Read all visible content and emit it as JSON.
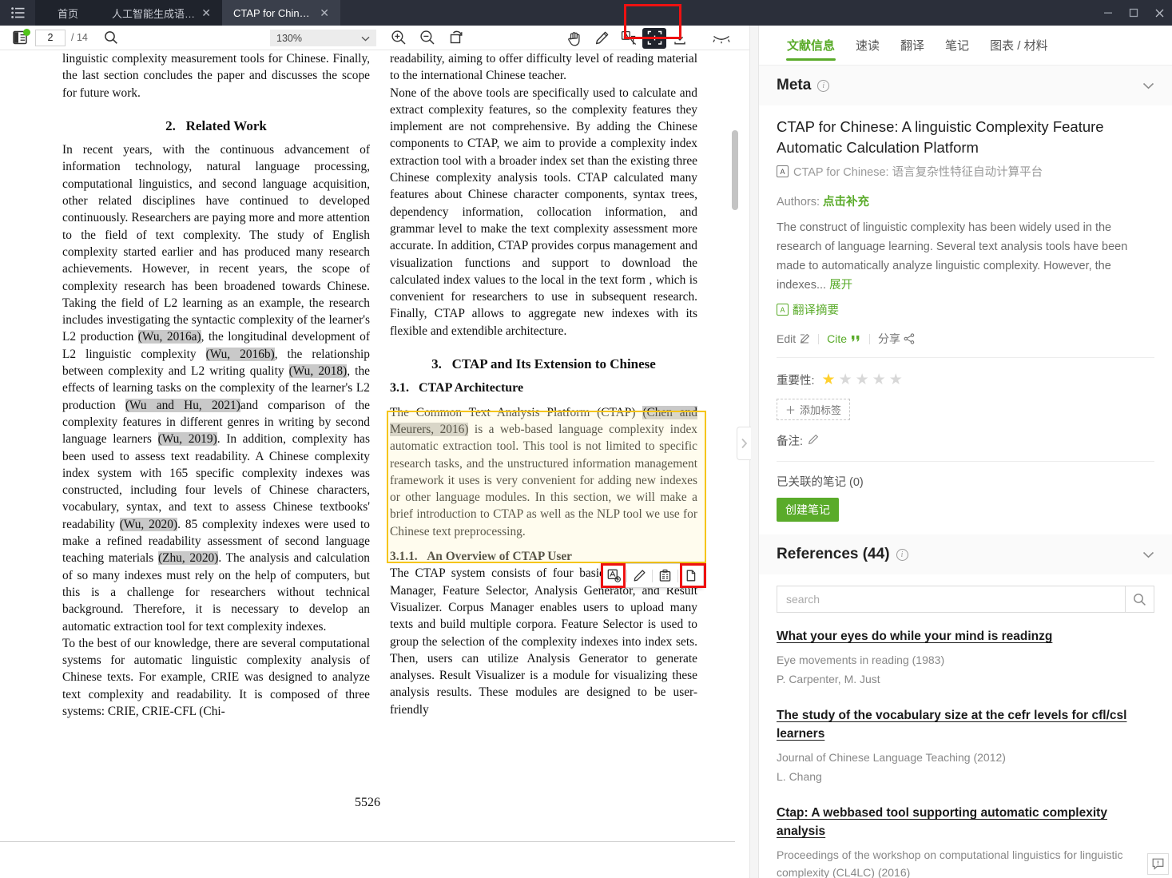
{
  "window": {
    "controls": {
      "minimize": "—",
      "maximize": "▢",
      "close": "✕"
    }
  },
  "tabs": [
    {
      "label": "首页",
      "closable": false,
      "active": false
    },
    {
      "label": "人工智能生成语言与...",
      "closable": true,
      "active": false
    },
    {
      "label": "CTAP for Chinese: A li...",
      "closable": true,
      "active": true
    }
  ],
  "pdf_toolbar": {
    "page_current": "2",
    "page_total": "/ 14",
    "zoom_level": "130%",
    "icons": [
      "sidebar-toggle-icon",
      "search-icon",
      "zoom-in-icon",
      "zoom-out-icon",
      "fit-page-icon",
      "hand-tool-icon",
      "pen-tool-icon",
      "translate-tool-icon",
      "screenshot-tool-icon",
      "download-icon",
      "eye-hidden-icon"
    ],
    "selected_tool": "screenshot-tool-icon"
  },
  "pdf": {
    "page_number": "5526",
    "left_column": {
      "intro_tail": "linguistic complexity measurement tools for Chinese. Finally, the last section concludes the paper and discusses the scope for future work.",
      "section2_number": "2.",
      "section2_title": "Related Work",
      "para1_a": "In recent years, with the continuous advancement of information technology, natural language processing, computational linguistics, and second language acquisition, other related disciplines have continued to developed continuously. Researchers are paying more and more attention to the field of text complexity. The study of English complexity started earlier and has produced many research achievements. However, in recent years, the scope of complexity research has been broadened towards Chinese. Taking the field of L2 learning as an example, the research includes investigating the syntactic complexity of the learner's L2 production ",
      "cite1": "(Wu, 2016a)",
      "para1_b": ", the longitudinal development of L2 linguistic complexity ",
      "cite2": "(Wu, 2016b)",
      "para1_c": ", the relationship between complexity and L2 writing quality ",
      "cite3": "(Wu, 2018)",
      "para1_d": ", the effects of learning tasks on the complexity of the learner's L2 production ",
      "cite4": "(Wu and Hu, 2021)",
      "para1_e": "and comparison of the complexity features in different genres in writing by second language learners ",
      "cite5": "(Wu, 2019)",
      "para1_f": ". In addition, complexity has been used to assess text readability. A Chinese complexity index system with 165 specific complexity indexes was constructed, including four levels of Chinese characters, vocabulary, syntax, and text to assess Chinese textbooks' readability ",
      "cite6": "(Wu, 2020)",
      "para1_g": ". 85 complexity indexes were used to make a refined readability assessment of second language teaching materials ",
      "cite7": "(Zhu, 2020)",
      "para1_h": ". The analysis and calculation of so many indexes must rely on the help of computers, but this is a challenge for researchers without technical background. Therefore, it is necessary to develop an automatic extraction tool for text complexity indexes.",
      "para2": "To the best of our knowledge, there are several computational systems for automatic linguistic complexity analysis of Chinese texts. For example, CRIE was designed to analyze text complexity and readability. It is composed of three systems: CRIE, CRIE-CFL (Chi-"
    },
    "right_column": {
      "para1": "readability, aiming to offer difficulty level of reading material to the international Chinese teacher.",
      "para2": "None of the above tools are specifically used to calculate and extract complexity features, so the complexity features they implement are not comprehensive. By adding the Chinese components to CTAP, we aim to provide a complexity index extraction tool with a broader index set than the existing three Chinese complexity analysis tools. CTAP calculated many features about Chinese character components, syntax trees, dependency information, collocation information, and grammar level to make the text complexity assessment more accurate. In addition, CTAP provides corpus management and visualization functions and support to download the calculated index values to the local in the text form , which is convenient for researchers to use in subsequent research. Finally, CTAP allows to aggregate new indexes with its flexible and extendible architecture.",
      "section3_number": "3.",
      "section3_title": "CTAP and Its Extension to Chinese",
      "section31_number": "3.1.",
      "section31_title": "CTAP Architecture",
      "highlight_a": "The Common Text Analysis Platform (CTAP) ",
      "highlight_cite": "(Chen and Meurers, 2016)",
      "highlight_b": " is a web-based language complexity index automatic extraction tool. This tool is not limited to specific research tasks, and the unstructured information management framework it uses is very convenient for adding new indexes or other language modules. In this section, we will make a brief introduction to CTAP as well as the NLP tool we use for Chinese text preprocessing.",
      "section311_number": "3.1.1.",
      "section311_title": "An Overview of CTAP User",
      "para3": "The CTAP system consists of four basic modules: Corpus Manager, Feature Selector, Analysis Generator, and Result Visualizer. Corpus Manager enables users to upload many texts and build multiple corpora. Feature Selector is used to group the selection of the complexity indexes into index sets. Then, users can utilize Analysis Generator to generate analyses. Result Visualizer is a module for visualizing these analysis results. These modules are designed to be user-friendly"
    },
    "floating_toolbar": {
      "icons": [
        "translate-selection-icon",
        "annotate-pen-icon",
        "add-note-icon",
        "copy-icon"
      ]
    }
  },
  "right_panel": {
    "tabs": [
      {
        "label": "文献信息",
        "active": true
      },
      {
        "label": "速读",
        "active": false
      },
      {
        "label": "翻译",
        "active": false
      },
      {
        "label": "笔记",
        "active": false
      },
      {
        "label": "图表 / 材料",
        "active": false
      }
    ],
    "meta": {
      "header": "Meta",
      "title": "CTAP for Chinese: A linguistic Complexity Feature Automatic Calculation Platform",
      "alt_title": "CTAP for Chinese: 语言复杂性特征自动计算平台",
      "authors_label": "Authors:",
      "authors_action": "点击补充",
      "abstract": "The construct of linguistic complexity has been widely used in the research of language learning. Several text analysis tools have been made to automatically analyze linguistic complexity. However, the indexes...",
      "abstract_expand": "展开",
      "translate_abstract": "翻译摘要",
      "edit_label": "Edit",
      "cite_label": "Cite",
      "share_label": "分享",
      "importance_label": "重要性:",
      "importance_value": 1,
      "importance_max": 5,
      "add_tag": "添加标签",
      "remark_label": "备注:",
      "linked_notes": "已关联的笔记 (0)",
      "create_note": "创建笔记"
    },
    "references": {
      "header": "References (44)",
      "search_placeholder": "search",
      "items": [
        {
          "title": "What your eyes do while your mind is readinzg",
          "venue": "Eye movements in reading (1983)",
          "authors": "P. Carpenter, M. Just"
        },
        {
          "title": "The study of the vocabulary size at the cefr levels for cfl/csl learners",
          "venue": "Journal of Chinese Language Teaching (2012)",
          "authors": "L. Chang"
        },
        {
          "title": "Ctap: A webbased tool supporting automatic complexity analysis",
          "venue": "Proceedings of the workshop on computational linguistics for linguistic complexity (CL4LC) (2016)",
          "authors": ""
        }
      ]
    }
  },
  "colors": {
    "accent_green": "#5aab2a",
    "titlebar": "#2b2f3a",
    "tab_active": "#3a3f4b",
    "star_gold": "#ffd02e",
    "annotation_red": "#ee1111",
    "selection_yellow": "#f5c518",
    "citation_highlight": "#c9c9c9"
  }
}
